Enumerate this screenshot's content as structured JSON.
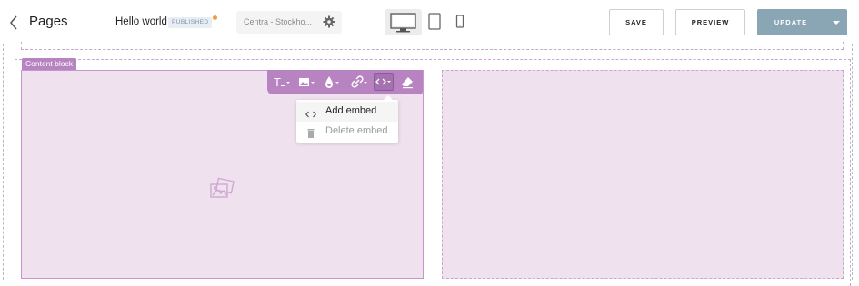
{
  "header": {
    "title": "Pages",
    "site_name": "Hello world",
    "status_badge": "PUBLISHED",
    "store_selector": "Centra - Stockho...",
    "save_label": "SAVE",
    "preview_label": "PREVIEW",
    "update_label": "UPDATE",
    "devices": [
      "desktop-icon",
      "tablet-icon",
      "mobile-icon"
    ],
    "active_device": "desktop"
  },
  "editor": {
    "block_tag": "Content block",
    "toolbar": [
      "text-format-icon",
      "image-icon",
      "color-drop-icon",
      "link-icon",
      "embed-code-icon",
      "eraser-icon"
    ],
    "embed_menu": {
      "items": [
        {
          "label": "Add embed",
          "icon": "code-icon",
          "enabled": true
        },
        {
          "label": "Delete embed",
          "icon": "trash-icon",
          "enabled": false
        }
      ]
    }
  },
  "colors": {
    "accent": "#b883c1",
    "block_bg": "#efe2ee",
    "update_button": "#8aa6b4",
    "status_dot": "#f39a3e"
  }
}
